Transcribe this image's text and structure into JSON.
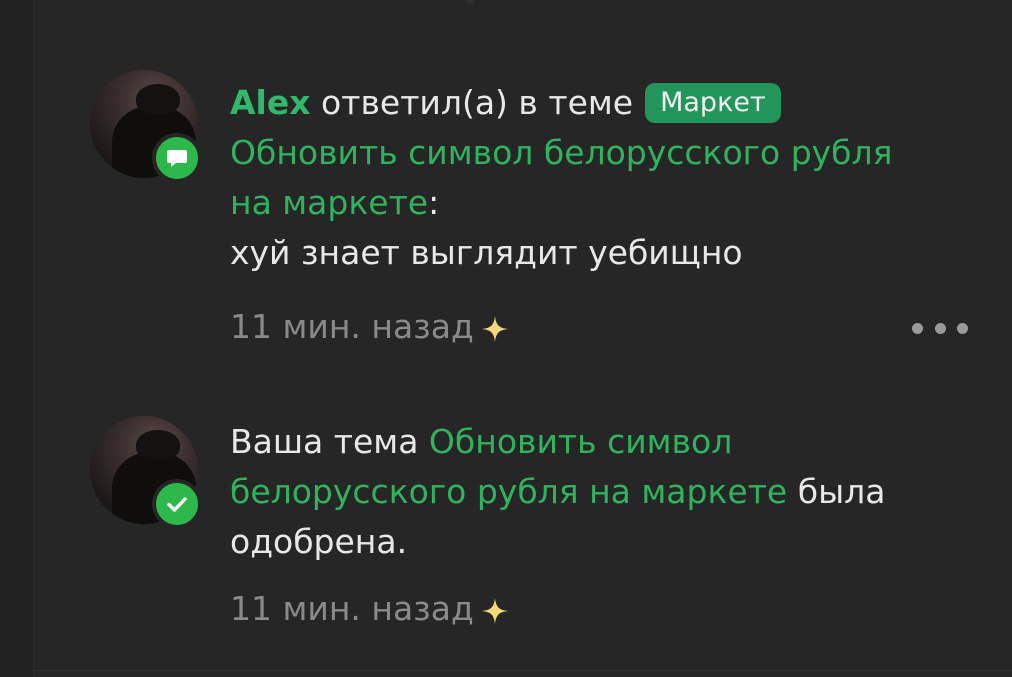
{
  "notifications": [
    {
      "type": "reply",
      "username": "Alex",
      "action_text": "ответил(а) в теме",
      "tag": "Маркет",
      "thread_title_line1": "Обновить символ белорусского рубля",
      "thread_title_line2": "на маркете",
      "colon": ":",
      "message": "хуй знает выглядит уебищно",
      "time": "11 мин. назад",
      "badge_icon": "speech-bubble-icon",
      "more_icon": "more-dots-icon"
    },
    {
      "type": "approved",
      "prefix": "Ваша тема",
      "thread_title_part1": "Обновить символ",
      "thread_title_part2": "белорусского рубля на маркете",
      "suffix_part1": "была",
      "suffix_part2": "одобрена.",
      "time": "11 мин. назад",
      "badge_icon": "checkmark-icon"
    }
  ],
  "colors": {
    "background": "#262626",
    "accent_green": "#2fb35f",
    "tag_green": "#22955a",
    "badge_green": "#2eb84b",
    "sparkle": "#f3d97a"
  }
}
